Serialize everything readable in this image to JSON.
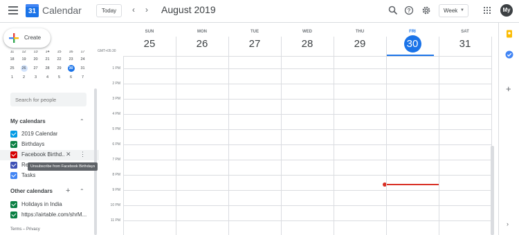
{
  "header": {
    "app_title": "Calendar",
    "logo_text": "31",
    "today_label": "Today",
    "month_title": "August 2019",
    "view_label": "Week",
    "avatar_initials": "My"
  },
  "sidebar": {
    "create_label": "Create",
    "mini_calendar": {
      "clipped_row": [
        "11",
        "12",
        "13",
        "14",
        "15",
        "16",
        "17"
      ],
      "rows": [
        [
          "18",
          "19",
          "20",
          "21",
          "22",
          "23",
          "24"
        ],
        [
          "25",
          "26",
          "27",
          "28",
          "29",
          "30",
          "31"
        ],
        [
          "1",
          "2",
          "3",
          "4",
          "5",
          "6",
          "7"
        ]
      ],
      "selected_day": "26",
      "today_day": "30"
    },
    "search_people_placeholder": "Search for people",
    "my_calendars_title": "My calendars",
    "my_calendars": [
      {
        "label": "2019 Calendar",
        "color": "#039be5"
      },
      {
        "label": "Birthdays",
        "color": "#0b8043"
      },
      {
        "label": "Facebook Birthd...",
        "color": "#d50000"
      },
      {
        "label": "Re",
        "color": "#3f51b5"
      },
      {
        "label": "Tasks",
        "color": "#4285f4"
      }
    ],
    "tooltip": "Unsubscribe from Facebook Birthdays",
    "other_calendars_title": "Other calendars",
    "other_calendars": [
      {
        "label": "Holidays in India",
        "color": "#0b8043"
      },
      {
        "label": "https://airtable.com/shrM...",
        "color": "#0b8043"
      }
    ],
    "footer": {
      "terms": "Terms",
      "separator": "–",
      "privacy": "Privacy"
    }
  },
  "grid": {
    "timezone": "GMT+05:30",
    "days": [
      {
        "dow": "SUN",
        "date": "25"
      },
      {
        "dow": "MON",
        "date": "26"
      },
      {
        "dow": "TUE",
        "date": "27"
      },
      {
        "dow": "WED",
        "date": "28"
      },
      {
        "dow": "THU",
        "date": "29"
      },
      {
        "dow": "FRI",
        "date": "30",
        "today": true
      },
      {
        "dow": "SAT",
        "date": "31"
      }
    ],
    "hours": [
      "1 PM",
      "2 PM",
      "3 PM",
      "4 PM",
      "5 PM",
      "6 PM",
      "7 PM",
      "8 PM",
      "9 PM",
      "10 PM",
      "11 PM"
    ],
    "accent_color": "#1a73e8",
    "now_indicator_color": "#d93025"
  },
  "icons": {
    "header": [
      "menu-icon",
      "chevron-left-icon",
      "chevron-right-icon",
      "search-icon",
      "help-icon",
      "settings-icon",
      "apps-icon"
    ],
    "side_panel": [
      "keep-icon",
      "tasks-icon",
      "add-icon",
      "chevron-right-icon"
    ]
  }
}
